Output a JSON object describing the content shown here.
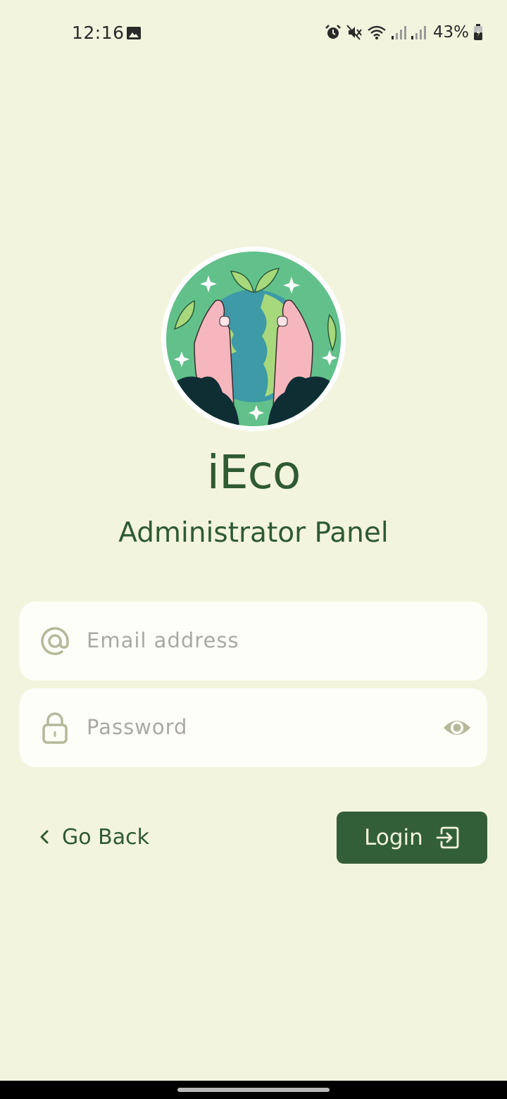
{
  "status_bar": {
    "time": "12:16",
    "battery_percent": "43%",
    "icons": [
      "gallery-icon",
      "alarm-icon",
      "mute-icon",
      "wifi-icon",
      "signal-icon",
      "signal-icon",
      "battery-icon"
    ]
  },
  "logo": {
    "icon": "earth-in-hands-logo"
  },
  "app": {
    "title": "iEco",
    "subtitle": "Administrator Panel"
  },
  "form": {
    "email": {
      "placeholder": "Email address",
      "value": "",
      "icon": "at-icon"
    },
    "password": {
      "placeholder": "Password",
      "value": "",
      "icon": "lock-icon",
      "toggle_icon": "eye-icon"
    }
  },
  "actions": {
    "go_back_label": "Go Back",
    "login_label": "Login"
  },
  "colors": {
    "background": "#f3f4dd",
    "primary_green": "#335f38",
    "text_green": "#2f5a32",
    "field_background": "#fdfef8",
    "icon_muted": "#b6b89a"
  }
}
